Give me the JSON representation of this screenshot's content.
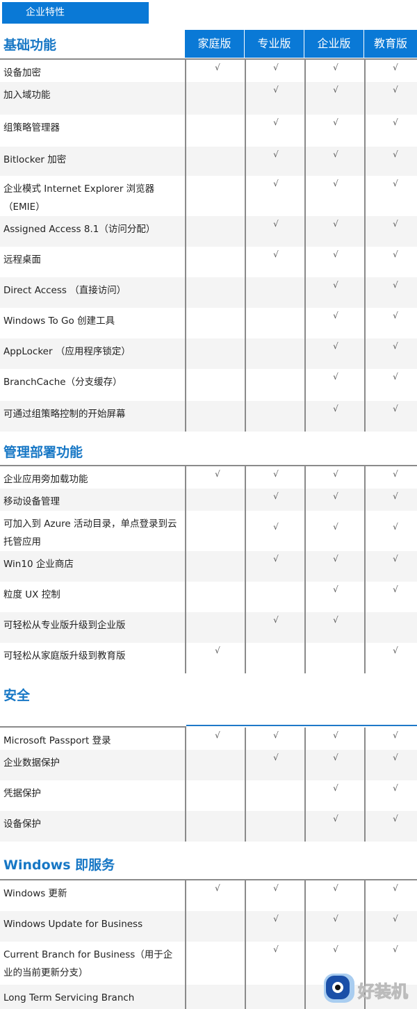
{
  "banner": "企业特性",
  "editions": [
    "家庭版",
    "专业版",
    "企业版",
    "教育版"
  ],
  "check_symbol": "√",
  "sections": [
    {
      "title": "基础功能",
      "rows": [
        {
          "label": "设备加密",
          "support": [
            true,
            true,
            true,
            true
          ]
        },
        {
          "label": "加入域功能",
          "support": [
            false,
            true,
            true,
            true
          ]
        },
        {
          "label": "组策略管理器",
          "support": [
            false,
            true,
            true,
            true
          ]
        },
        {
          "label": "Bitlocker 加密",
          "support": [
            false,
            true,
            true,
            true
          ]
        },
        {
          "label": "企业模式 Internet Explorer 浏览器（EMIE）",
          "support": [
            false,
            true,
            true,
            true
          ]
        },
        {
          "label": "Assigned Access 8.1（访问分配）",
          "support": [
            false,
            true,
            true,
            true
          ]
        },
        {
          "label": "远程桌面",
          "support": [
            false,
            true,
            true,
            true
          ]
        },
        {
          "label": "Direct Access （直接访问）",
          "support": [
            false,
            false,
            true,
            true
          ]
        },
        {
          "label": "Windows To Go 创建工具",
          "support": [
            false,
            false,
            true,
            true
          ]
        },
        {
          "label": "AppLocker （应用程序锁定）",
          "support": [
            false,
            false,
            true,
            true
          ]
        },
        {
          "label": "BranchCache（分支缓存）",
          "support": [
            false,
            false,
            true,
            true
          ]
        },
        {
          "label": "可通过组策略控制的开始屏幕",
          "support": [
            false,
            false,
            true,
            true
          ]
        }
      ]
    },
    {
      "title": "管理部署功能",
      "rows": [
        {
          "label": "企业应用旁加载功能",
          "support": [
            true,
            true,
            true,
            true
          ]
        },
        {
          "label": "移动设备管理",
          "support": [
            false,
            true,
            true,
            true
          ]
        },
        {
          "label": "可加入到 Azure 活动目录，单点登录到云托管应用",
          "support": [
            false,
            true,
            true,
            true
          ]
        },
        {
          "label": "Win10 企业商店",
          "support": [
            false,
            true,
            true,
            true
          ]
        },
        {
          "label": "粒度 UX 控制",
          "support": [
            false,
            false,
            true,
            true
          ]
        },
        {
          "label": "可轻松从专业版升级到企业版",
          "support": [
            false,
            true,
            true,
            false
          ]
        },
        {
          "label": "可轻松从家庭版升级到教育版",
          "support": [
            true,
            false,
            false,
            true
          ]
        }
      ]
    },
    {
      "title": "安全",
      "rows": [
        {
          "label": "Microsoft Passport 登录",
          "support": [
            true,
            true,
            true,
            true
          ]
        },
        {
          "label": "企业数据保护",
          "support": [
            false,
            true,
            true,
            true
          ]
        },
        {
          "label": "凭据保护",
          "support": [
            false,
            false,
            true,
            true
          ]
        },
        {
          "label": "设备保护",
          "support": [
            false,
            false,
            true,
            true
          ]
        }
      ]
    },
    {
      "title": "Windows 即服务",
      "rows": [
        {
          "label": "Windows 更新",
          "support": [
            true,
            true,
            true,
            true
          ]
        },
        {
          "label": "Windows Update for Business",
          "support": [
            false,
            true,
            true,
            true
          ]
        },
        {
          "label": "Current Branch for Business（用于企业的当前更新分支）",
          "support": [
            false,
            true,
            true,
            true
          ]
        },
        {
          "label": "Long Term Servicing Branch",
          "support": [
            null,
            null,
            null,
            null
          ]
        }
      ]
    }
  ],
  "watermark": {
    "icon": "eye-mascot-icon",
    "text": "好装机"
  }
}
